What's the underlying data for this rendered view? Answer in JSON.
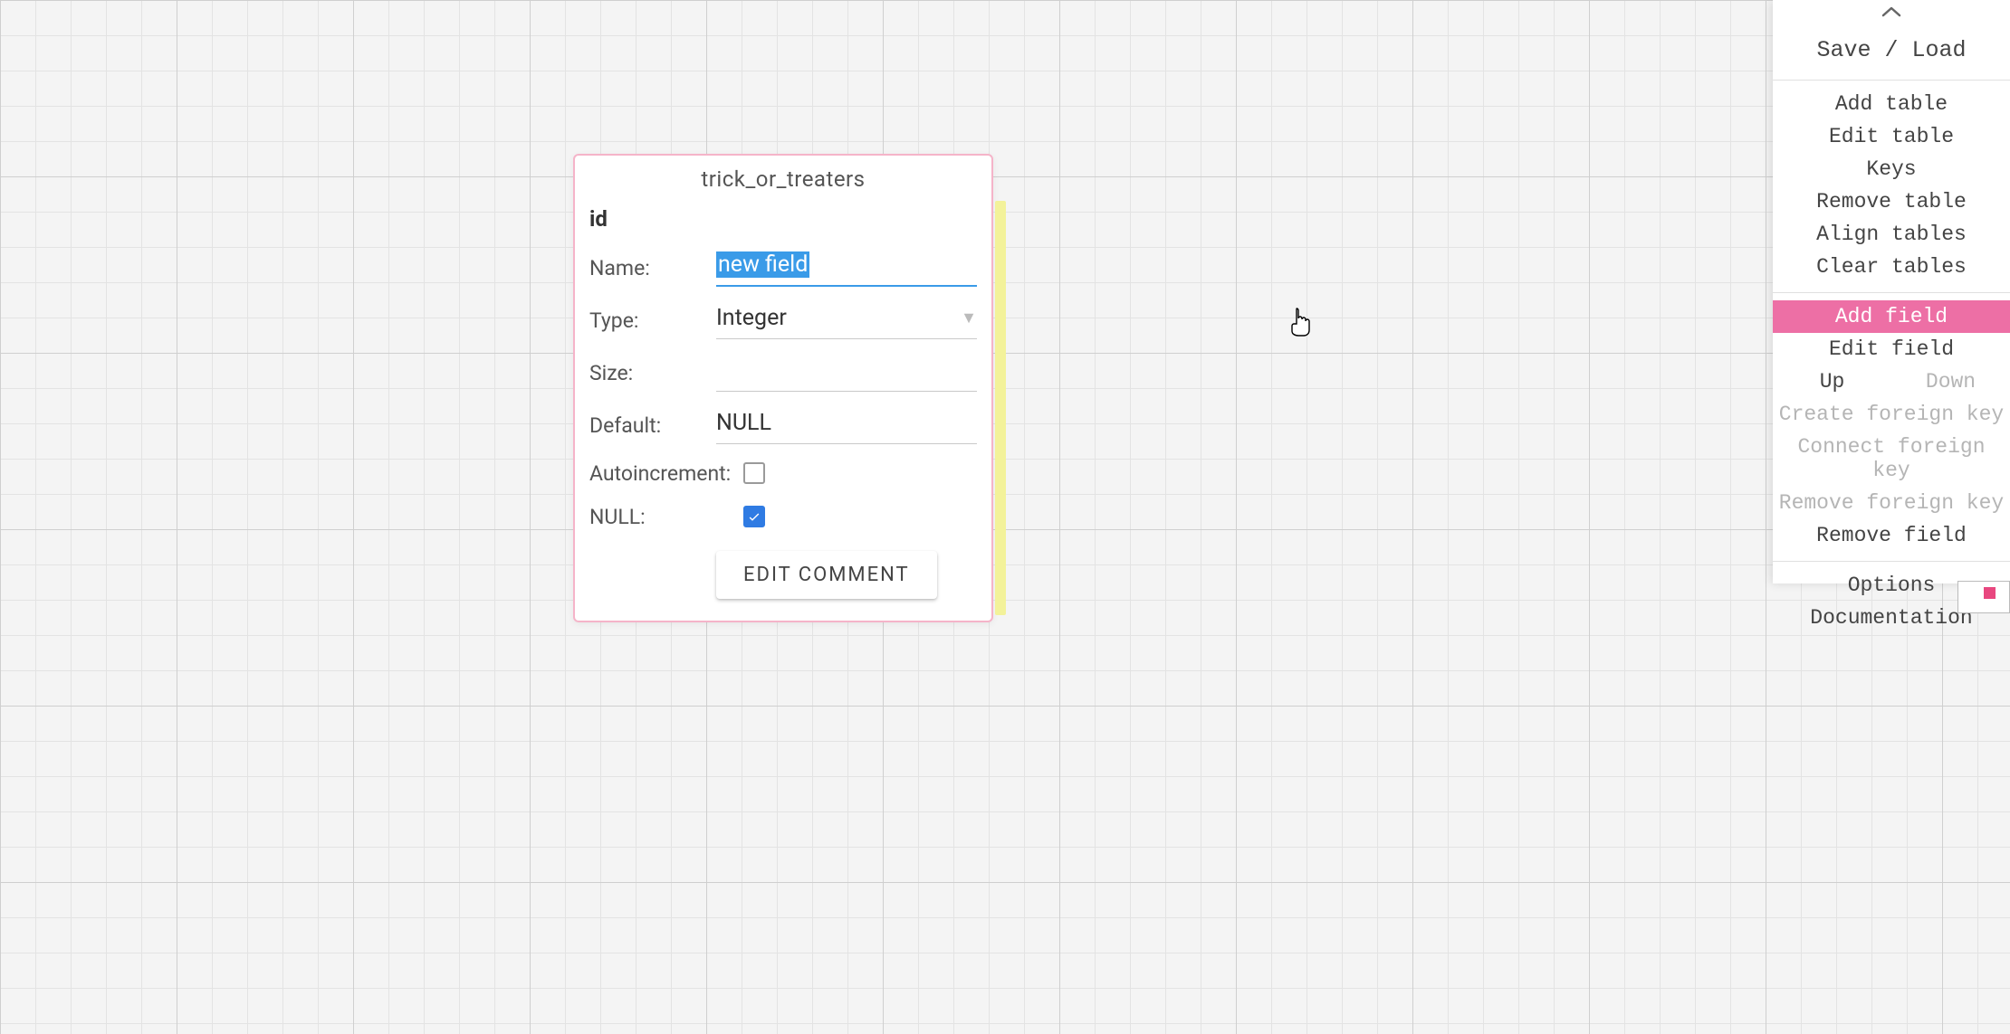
{
  "canvas": {},
  "table": {
    "title": "trick_or_treaters",
    "existing_field": "id",
    "form": {
      "name_label": "Name:",
      "name_value": "new field",
      "type_label": "Type:",
      "type_value": "Integer",
      "size_label": "Size:",
      "size_value": "",
      "default_label": "Default:",
      "default_value": "NULL",
      "ai_label": "Autoincrement:",
      "ai_checked": false,
      "null_label": "NULL:",
      "null_checked": true,
      "edit_comment_label": "EDIT COMMENT"
    }
  },
  "sidebar": {
    "save_load": "Save / Load",
    "add_table": "Add table",
    "edit_table": "Edit table",
    "keys": "Keys",
    "remove_table": "Remove table",
    "align_tables": "Align tables",
    "clear_tables": "Clear tables",
    "add_field": "Add field",
    "edit_field": "Edit field",
    "up": "Up",
    "down": "Down",
    "create_fk": "Create foreign key",
    "connect_fk": "Connect foreign key",
    "remove_fk": "Remove foreign key",
    "remove_field": "Remove field",
    "options": "Options",
    "documentation": "Documentation"
  }
}
